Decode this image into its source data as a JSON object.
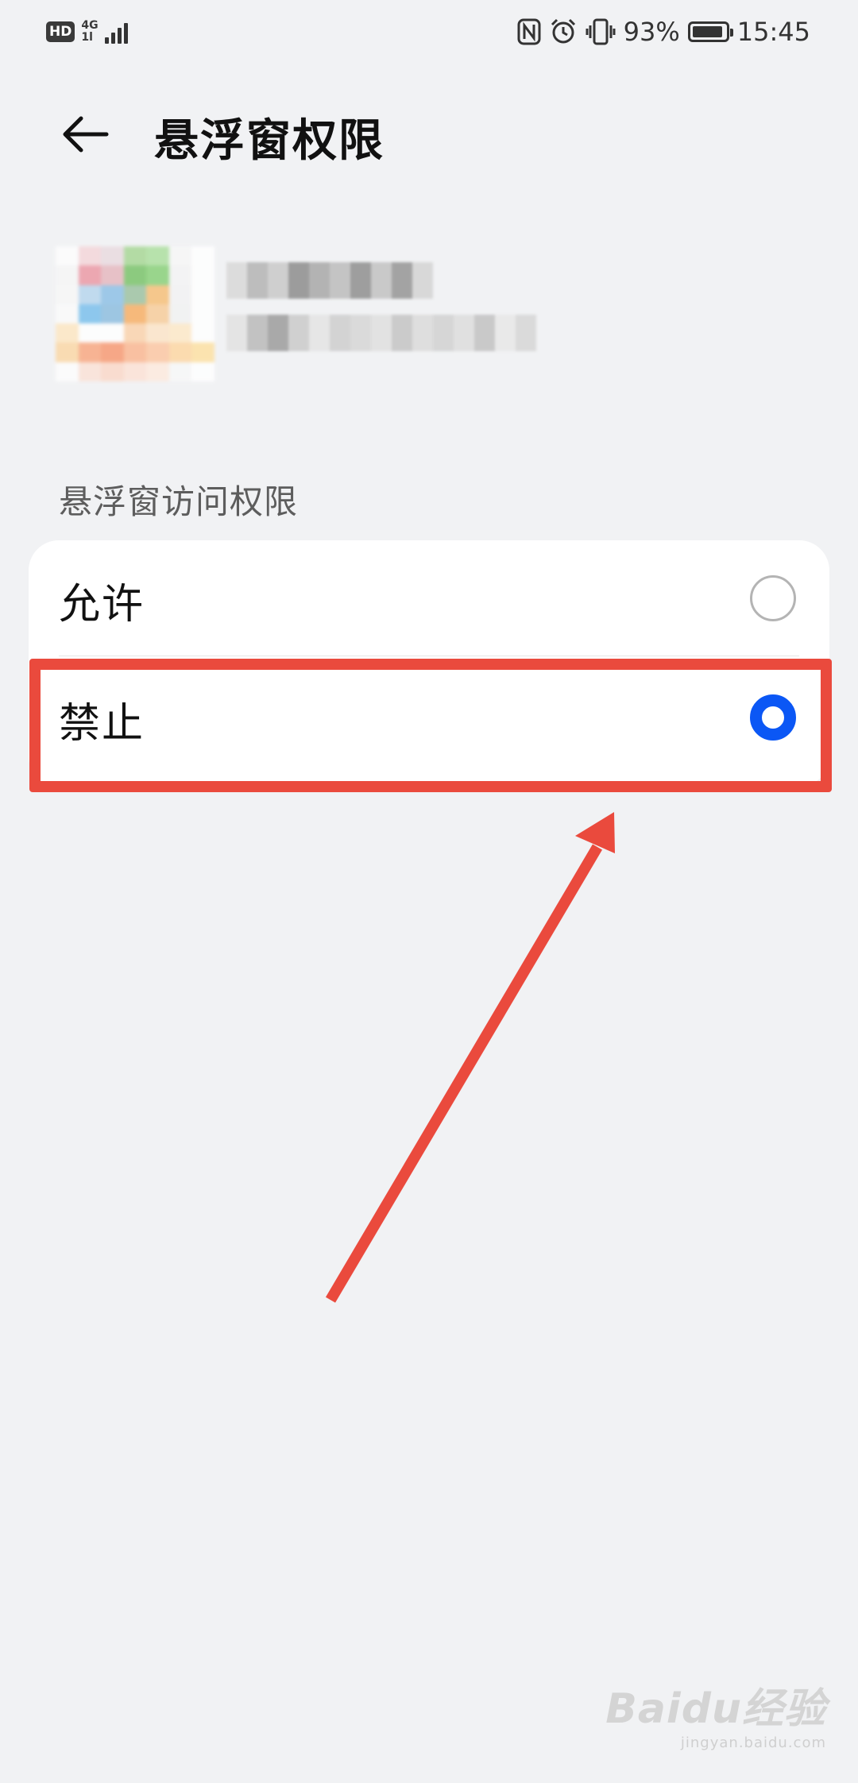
{
  "status_bar": {
    "hd": "HD",
    "network": "4G",
    "network_sub": "1l",
    "battery": "93%",
    "battery_level": 0.93,
    "time": "15:45"
  },
  "header": {
    "title": "悬浮窗权限"
  },
  "section": {
    "label": "悬浮窗访问权限"
  },
  "options": [
    {
      "label": "允许",
      "selected": false
    },
    {
      "label": "禁止",
      "selected": true
    }
  ],
  "colors": {
    "background": "#f1f2f4",
    "card": "#ffffff",
    "accent": "#0b57f5",
    "annotation": "#ea4a3d"
  },
  "watermark": {
    "main": "Baidu经验",
    "sub": "jingyan.baidu.com"
  }
}
